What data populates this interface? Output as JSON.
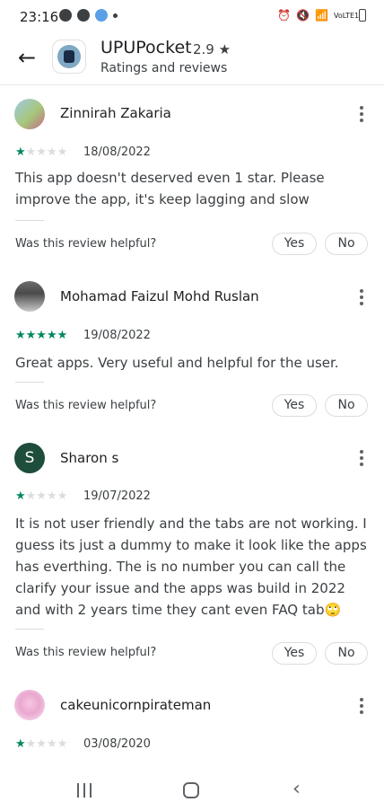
{
  "status_bar": {
    "time": "23:16",
    "network": "VoLTE1"
  },
  "header": {
    "app_name": "UPUPocket",
    "rating": "2.9 ★",
    "subtitle": "Ratings and reviews"
  },
  "colors": {
    "star_on": "#01875f",
    "star_off": "#dadce0",
    "letter_avatar_bg": "#1e4d3c"
  },
  "reviews": [
    {
      "author": "Zinnirah Zakaria",
      "stars": 1,
      "date": "18/08/2022",
      "text": "This app doesn't deserved even 1 star. Please improve the app, it's keep lagging and slow",
      "helpful_prompt": "Was this review helpful?",
      "yes_label": "Yes",
      "no_label": "No"
    },
    {
      "author": "Mohamad Faizul Mohd Ruslan",
      "stars": 5,
      "date": "19/08/2022",
      "text": "Great apps. Very useful and helpful for the user.",
      "helpful_prompt": "Was this review helpful?",
      "yes_label": "Yes",
      "no_label": "No"
    },
    {
      "author": "Sharon s",
      "avatar_letter": "S",
      "stars": 1,
      "date": "19/07/2022",
      "text": "It is not user friendly and the tabs are not working. I guess its just a dummy to make it look like the apps has everthing. The is no number you can call the clarify your issue and the apps was build in 2022 and with 2 years time they cant even FAQ tab🙄",
      "helpful_prompt": "Was this review helpful?",
      "yes_label": "Yes",
      "no_label": "No"
    },
    {
      "author": "cakeunicornpirateman",
      "stars": 1,
      "date": "03/08/2020"
    }
  ]
}
